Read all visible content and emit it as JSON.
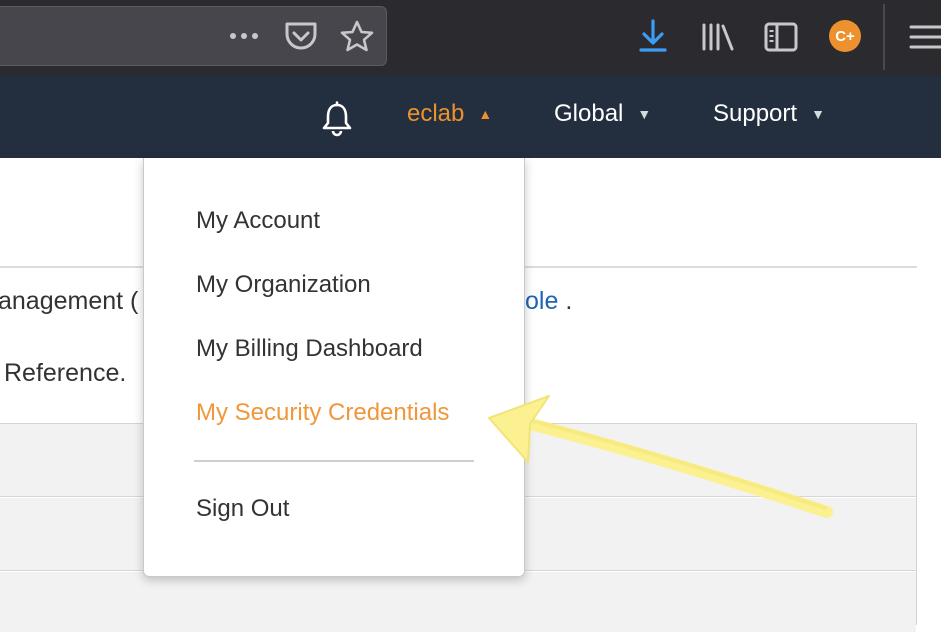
{
  "browser": {
    "toolbar": {
      "more_icon": "ellipsis-icon",
      "pocket_icon": "pocket-icon",
      "bookmark_icon": "star-icon",
      "download_icon": "download-icon",
      "library_icon": "library-icon",
      "sidebar_icon": "sidebar-icon",
      "extension_badge": "C+",
      "menu_icon": "hamburger-icon"
    }
  },
  "nav": {
    "bell_icon": "bell-icon",
    "account_label": "eclab",
    "region_label": "Global",
    "support_label": "Support"
  },
  "content": {
    "line1_text": "anagement (",
    "line1_link": "ole",
    "line1_suffix": ".",
    "line2_text": "Reference."
  },
  "account_menu": {
    "items": [
      {
        "label": "My Account"
      },
      {
        "label": "My Organization"
      },
      {
        "label": "My Billing Dashboard"
      },
      {
        "label": "My Security Credentials",
        "highlighted": true
      }
    ],
    "sign_out_label": "Sign Out"
  },
  "colors": {
    "nav_background": "#232f3e",
    "accent_orange": "#ec912d",
    "highlight_orange": "#f0963b",
    "link_blue": "#1f63b6",
    "download_blue": "#3d9df5",
    "annotation_yellow": "#fbf190"
  }
}
